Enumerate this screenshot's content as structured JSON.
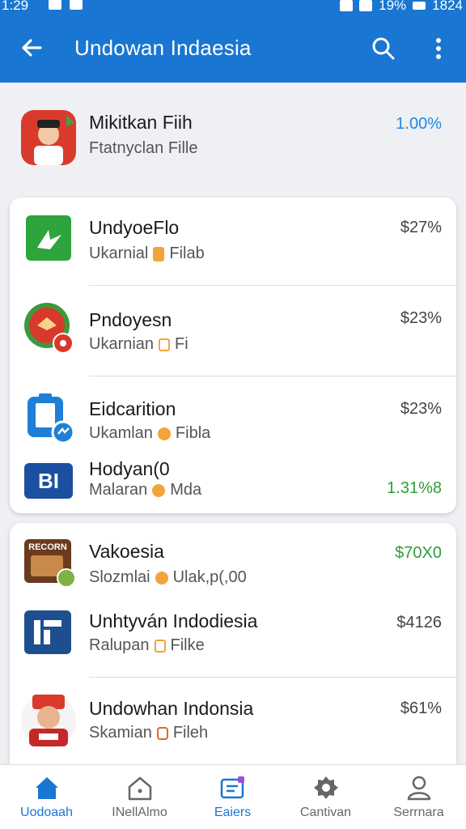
{
  "status_bar": {
    "time": "1:29",
    "battery": "19%",
    "clock_right": "1824"
  },
  "app_bar": {
    "title": "Undowan Indaesia"
  },
  "items": [
    {
      "name": "Mikitkan Fiih",
      "sub": "Ftatnyclan Fille",
      "value": "1.00%"
    },
    {
      "name": "UndyoeFlo",
      "sub": "Ukarnial",
      "sub2": "Filab",
      "value": "$27%"
    },
    {
      "name": "Pndoyesn",
      "sub": "Ukarnian",
      "sub2": "Fi",
      "value": "$23%"
    },
    {
      "name": "Eidcarition",
      "sub": "Ukamlan",
      "sub2": "Fibla",
      "value": "$23%"
    },
    {
      "name": "Hodyan(0",
      "sub": "Malaran",
      "sub2": "Mda",
      "value": "1.31%8",
      "logo": "BI"
    },
    {
      "name": "Vakoesia",
      "sub": "Slozmlai",
      "sub2": "Ulak,p(,00",
      "value": "$70X0",
      "logo": "RECORN"
    },
    {
      "name": "Unhtyván Indodiesia",
      "sub": "Ralupan",
      "sub2": "Filke",
      "value": "$4126"
    },
    {
      "name": "Undowhan Indonsia",
      "sub": "Skamian",
      "sub2": "Fileh",
      "value": "$61%"
    }
  ],
  "bottom_nav": [
    {
      "label": "Uodoaah",
      "icon": "home-filled-icon"
    },
    {
      "label": "INellAlmo",
      "icon": "home-outline-icon"
    },
    {
      "label": "Eaiers",
      "icon": "folder-icon"
    },
    {
      "label": "Cantivan",
      "icon": "gear-icon"
    },
    {
      "label": "Serrnara",
      "icon": "person-icon"
    }
  ],
  "colors": {
    "primary": "#1976d2",
    "accent_blue": "#1e88e5",
    "accent_green": "#2e9d3a",
    "tag_orange": "#f2a43a"
  }
}
